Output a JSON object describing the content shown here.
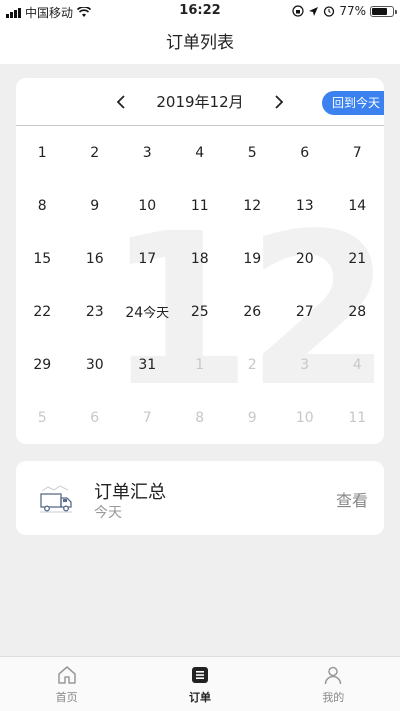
{
  "status_bar": {
    "carrier": "中国移动",
    "time": "16:22",
    "battery": "77%",
    "battery_level": 0.77
  },
  "navbar": {
    "title": "订单列表"
  },
  "calendar": {
    "title": "2019年12月",
    "today_button": "回到今天",
    "watermark": "12",
    "rows": [
      [
        {
          "d": "1"
        },
        {
          "d": "2"
        },
        {
          "d": "3"
        },
        {
          "d": "4"
        },
        {
          "d": "5"
        },
        {
          "d": "6"
        },
        {
          "d": "7"
        }
      ],
      [
        {
          "d": "8"
        },
        {
          "d": "9"
        },
        {
          "d": "10"
        },
        {
          "d": "11"
        },
        {
          "d": "12"
        },
        {
          "d": "13"
        },
        {
          "d": "14"
        }
      ],
      [
        {
          "d": "15"
        },
        {
          "d": "16"
        },
        {
          "d": "17"
        },
        {
          "d": "18"
        },
        {
          "d": "19"
        },
        {
          "d": "20"
        },
        {
          "d": "21"
        }
      ],
      [
        {
          "d": "22"
        },
        {
          "d": "23"
        },
        {
          "d": "24",
          "sub": "今天",
          "selected": true
        },
        {
          "d": "25"
        },
        {
          "d": "26"
        },
        {
          "d": "27"
        },
        {
          "d": "28"
        }
      ],
      [
        {
          "d": "29"
        },
        {
          "d": "30"
        },
        {
          "d": "31"
        },
        {
          "d": "1",
          "other": true
        },
        {
          "d": "2",
          "other": true
        },
        {
          "d": "3",
          "other": true
        },
        {
          "d": "4",
          "other": true
        }
      ],
      [
        {
          "d": "5",
          "other": true
        },
        {
          "d": "6",
          "other": true
        },
        {
          "d": "7",
          "other": true
        },
        {
          "d": "8",
          "other": true
        },
        {
          "d": "9",
          "other": true
        },
        {
          "d": "10",
          "other": true
        },
        {
          "d": "11",
          "other": true
        }
      ]
    ]
  },
  "summary": {
    "icon": "truck-icon",
    "title": "订单汇总",
    "subtitle": "今天",
    "action": "查看"
  },
  "tabs": [
    {
      "label": "首页",
      "icon": "home-icon"
    },
    {
      "label": "订单",
      "icon": "order-icon",
      "active": true
    },
    {
      "label": "我的",
      "icon": "profile-icon"
    }
  ],
  "colors": {
    "accent": "#3b82f0",
    "selected": "#4a90f0"
  }
}
